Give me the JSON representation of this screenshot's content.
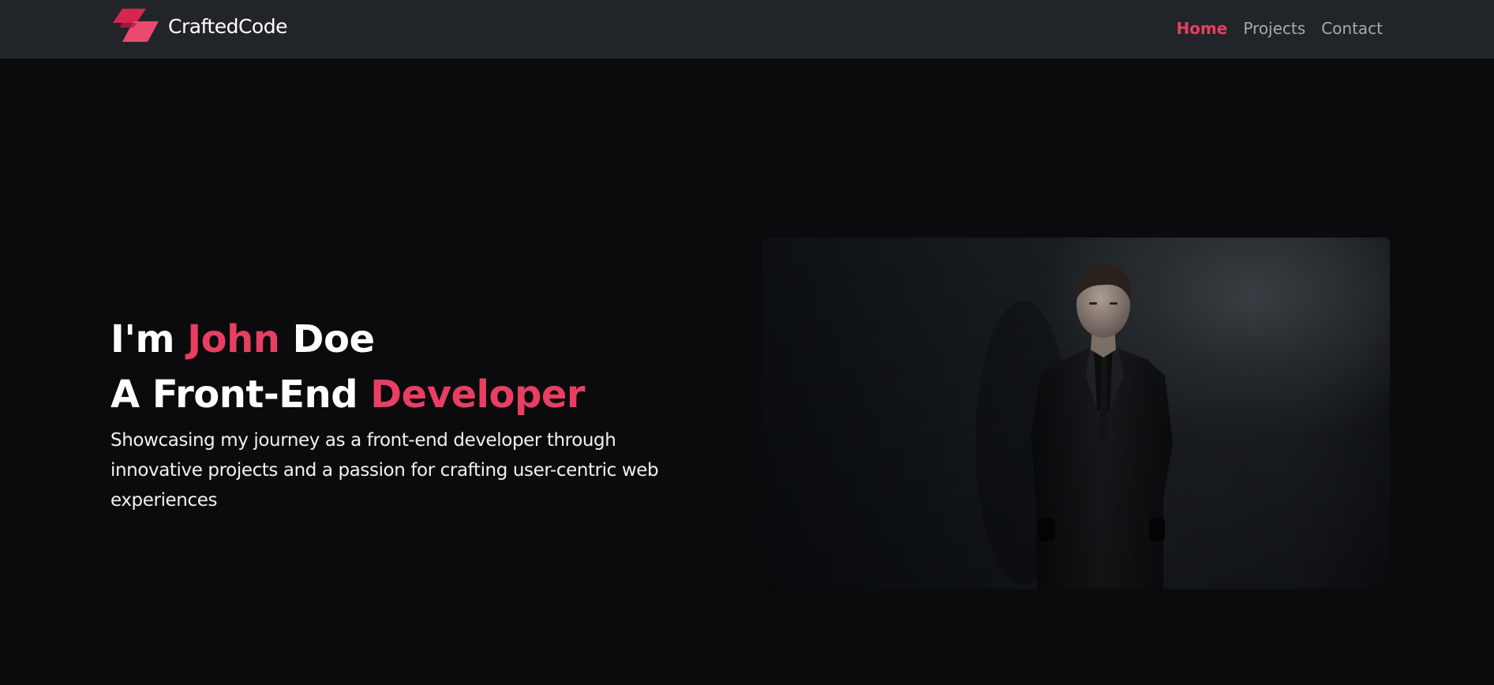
{
  "navbar": {
    "brand": "CraftedCode",
    "links": [
      {
        "label": "Home",
        "active": true
      },
      {
        "label": "Projects",
        "active": false
      },
      {
        "label": "Contact",
        "active": false
      }
    ]
  },
  "hero": {
    "line1": {
      "pre": "I'm ",
      "accent": "John",
      "post": " Doe"
    },
    "line2": {
      "pre": "A Front-End ",
      "accent": "Developer"
    },
    "description": "Showcasing my journey as a front-end developer through innovative projects and a passion for crafting user-centric web experiences",
    "image": "portrait-photo"
  },
  "colors": {
    "accent": "#e83e62",
    "navbar_bg": "#212529",
    "page_bg": "#0b0b0d",
    "nav_link": "#a7a9ac"
  }
}
